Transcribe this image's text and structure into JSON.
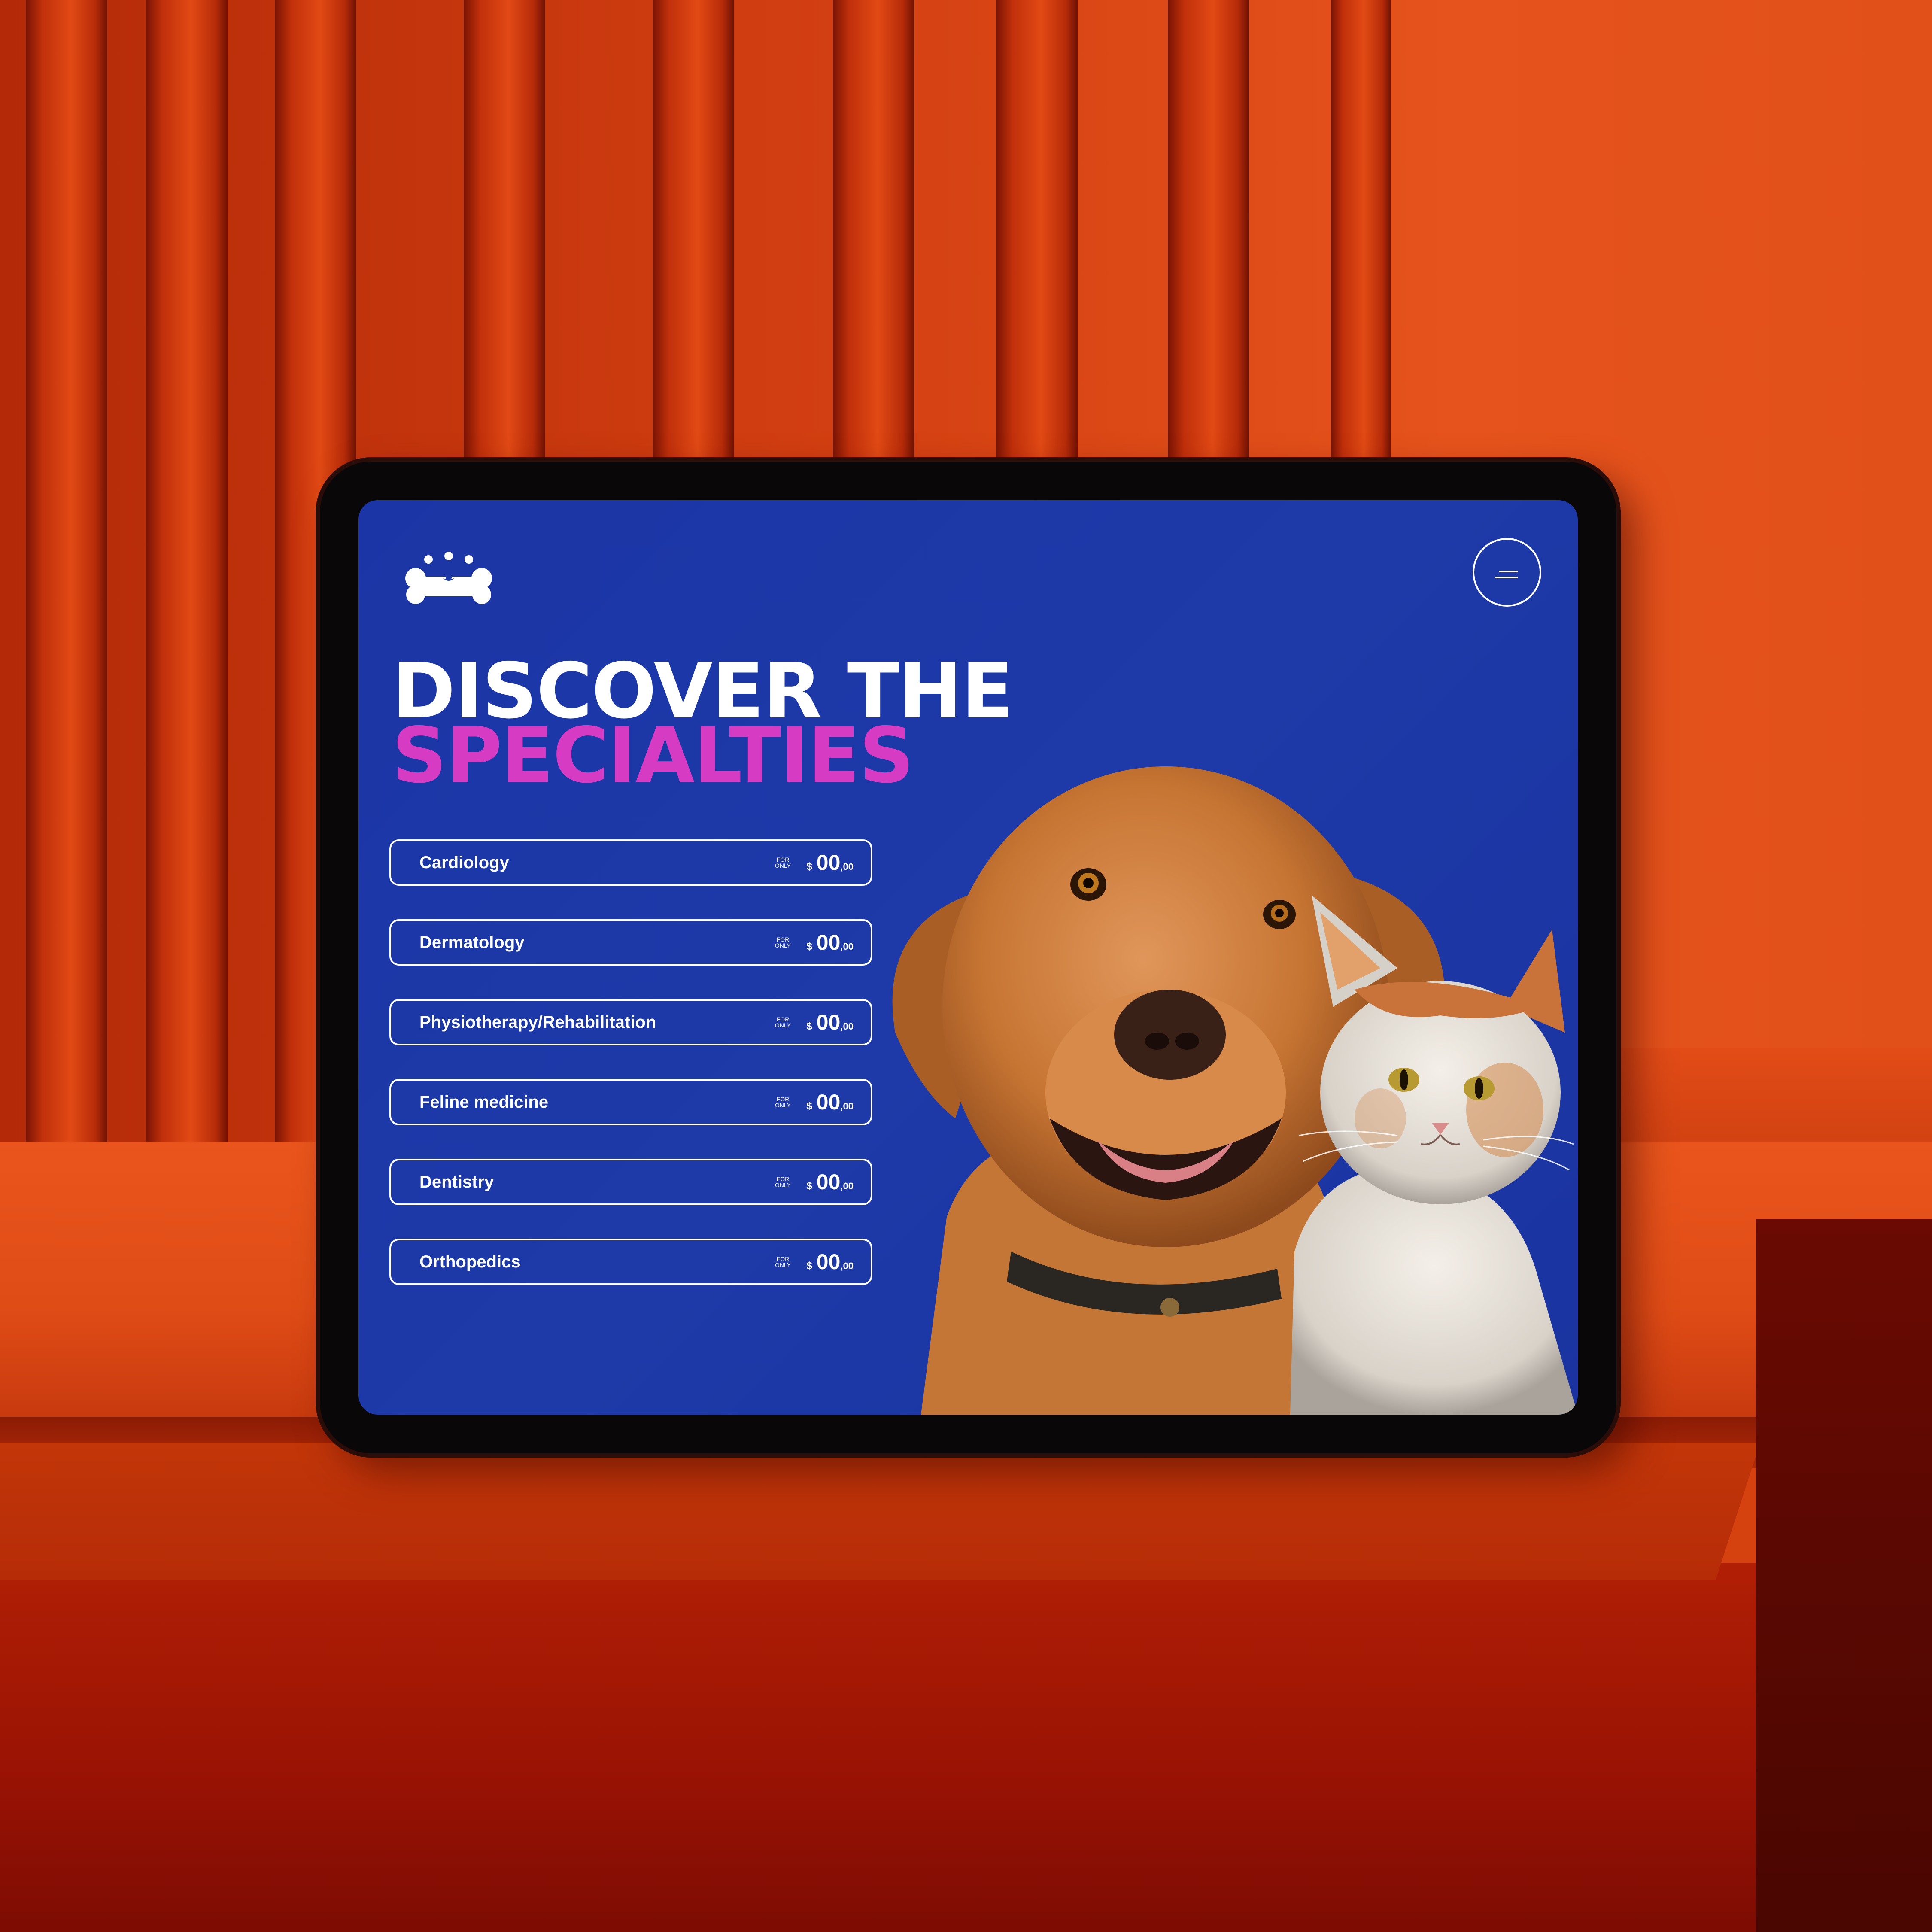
{
  "headline": {
    "line1": "DISCOVER THE",
    "line2": "SPECIALTIES"
  },
  "colors": {
    "screen_background": "#1d3aa8",
    "headline_accent": "#d63bc4",
    "text": "#ffffff"
  },
  "icons": {
    "logo": "dog-bone-logo-icon",
    "menu": "hamburger-menu-icon"
  },
  "specialties": [
    {
      "name": "Cardiology",
      "for_only": [
        "FOR",
        "ONLY"
      ],
      "currency": "$",
      "price_main": "00",
      "price_decimal": ",00"
    },
    {
      "name": "Dermatology",
      "for_only": [
        "FOR",
        "ONLY"
      ],
      "currency": "$",
      "price_main": "00",
      "price_decimal": ",00"
    },
    {
      "name": "Physiotherapy/Rehabilitation",
      "for_only": [
        "FOR",
        "ONLY"
      ],
      "currency": "$",
      "price_main": "00",
      "price_decimal": ",00"
    },
    {
      "name": "Feline medicine",
      "for_only": [
        "FOR",
        "ONLY"
      ],
      "currency": "$",
      "price_main": "00",
      "price_decimal": ",00"
    },
    {
      "name": "Dentistry",
      "for_only": [
        "FOR",
        "ONLY"
      ],
      "currency": "$",
      "price_main": "00",
      "price_decimal": ",00"
    },
    {
      "name": "Orthopedics",
      "for_only": [
        "FOR",
        "ONLY"
      ],
      "currency": "$",
      "price_main": "00",
      "price_decimal": ",00"
    }
  ]
}
